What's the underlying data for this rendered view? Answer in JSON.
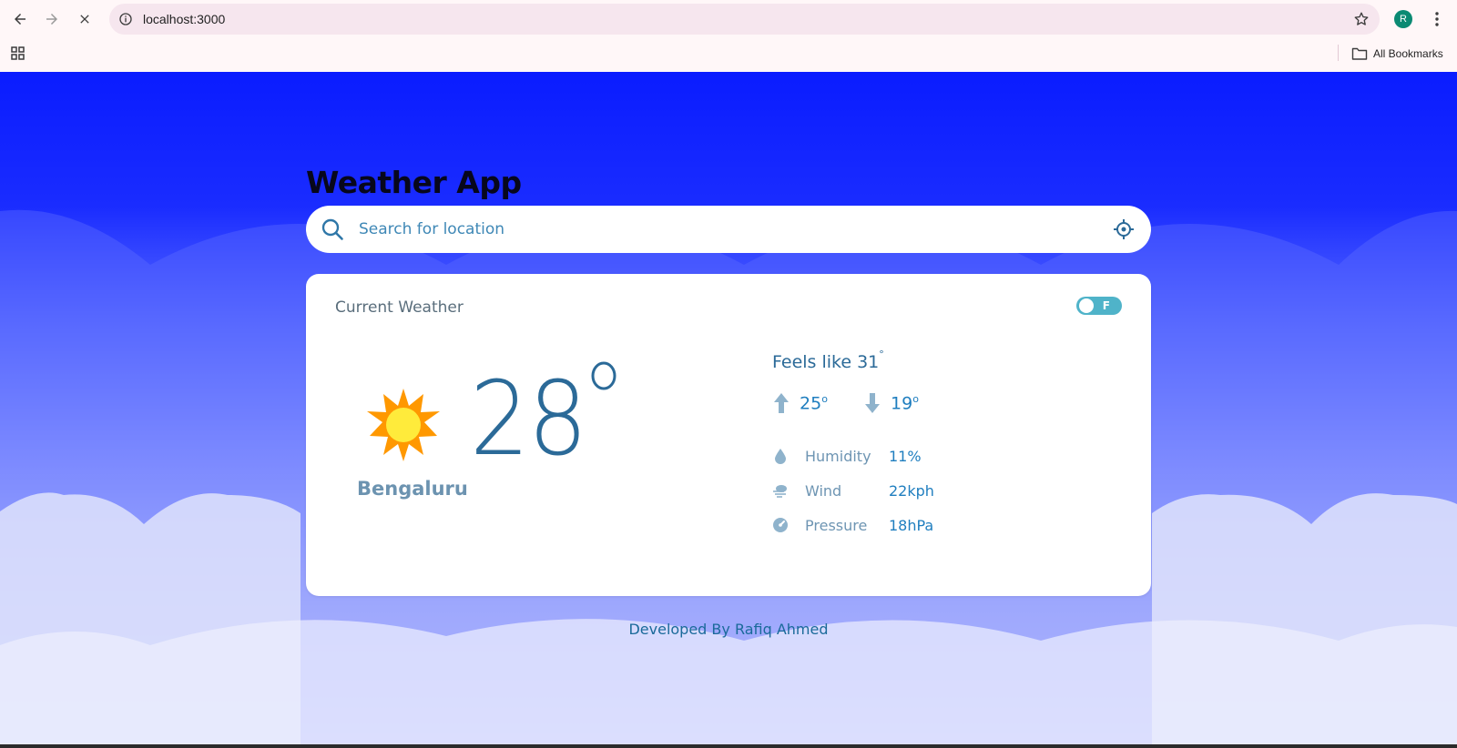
{
  "browser": {
    "url": "localhost:3000",
    "avatar_initial": "R",
    "bookmarks_label": "All Bookmarks"
  },
  "app": {
    "title": "Weather App",
    "search_placeholder": "Search for location",
    "footer": "Developed By Rafiq Ahmed"
  },
  "weather": {
    "card_title": "Current Weather",
    "unit_toggle_label": "F",
    "unit_toggle_on": false,
    "icon": "sun-icon",
    "temperature": "28",
    "city": "Bengaluru",
    "feels_like_label": "Feels like 31",
    "feels_like_degree": "°",
    "high": "25",
    "low": "19",
    "degree_symbol": "o",
    "stats": [
      {
        "icon": "humidity-icon",
        "label": "Humidity",
        "value": "11%"
      },
      {
        "icon": "wind-icon",
        "label": "Wind",
        "value": "22kph"
      },
      {
        "icon": "pressure-icon",
        "label": "Pressure",
        "value": "18hPa"
      }
    ]
  },
  "colors": {
    "sky_top": "#0a1cff",
    "sky_bottom": "#f4f5fd",
    "accent_text": "#2b6a98",
    "value_text": "#1f7ebf",
    "toggle": "#4fb3c9",
    "sun_outer": "#ff9800",
    "sun_inner": "#ffeb3b"
  }
}
